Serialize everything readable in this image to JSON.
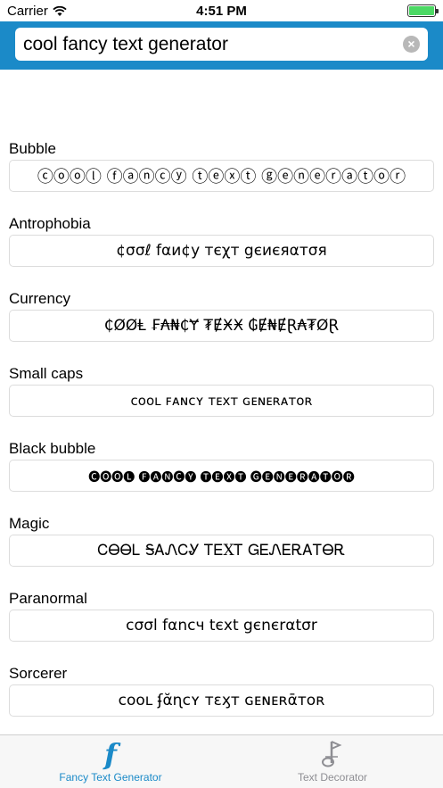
{
  "status_bar": {
    "carrier": "Carrier",
    "time": "4:51 PM"
  },
  "search": {
    "value": "cool fancy text generator"
  },
  "styles": [
    {
      "name": "Bubble",
      "output": "ⓒⓞⓞⓛ ⓕⓐⓝⓒⓨ ⓣⓔⓧⓣ ⓖⓔⓝⓔⓡⓐⓣⓞⓡ"
    },
    {
      "name": "Antrophobia",
      "output": "¢σσℓ fαи¢у тєχт gєиєяαтσя"
    },
    {
      "name": "Currency",
      "output": "₵ØØⱠ ₣₳₦₵Ɏ ₮ɆӾӾ ₲Ɇ₦ɆⱤ₳₮ØⱤ"
    },
    {
      "name": "Small caps",
      "output": "ᴄᴏᴏʟ ꜰᴀɴᴄʏ ᴛᴇxᴛ ɢᴇɴᴇʀᴀᴛᴏʀ"
    },
    {
      "name": "Black bubble",
      "output": "🅒🅞🅞🅛 🅕🅐🅝🅒🅨 🅣🅔🅧🅣 🅖🅔🅝🅔🅡🅐🅣🅞🅡"
    },
    {
      "name": "Magic",
      "output": "ᏟᎾᎾᏞ ᎦᎪᏁᏟᎽ ᎢᎬXᎢ ᏀᎬᏁᎬᎡᎪᎢᎾᎡ"
    },
    {
      "name": "Paranormal",
      "output": "cσσl fαncч tєхt gєnєrαtσr"
    },
    {
      "name": "Sorcerer",
      "output": "ᴄᴏᴏʟ ʄᾰɳᴄʏ ᴛɛӽᴛ ɢᴇɴᴇʀᾱᴛᴏʀ"
    }
  ],
  "tabs": [
    {
      "label": "Fancy Text Generator",
      "icon": "f",
      "active": true
    },
    {
      "label": "Text Decorator",
      "icon": "decorator",
      "active": false
    }
  ],
  "colors": {
    "accent": "#1b8ac8",
    "inactive": "#8e8e93",
    "battery": "#4cd964"
  }
}
